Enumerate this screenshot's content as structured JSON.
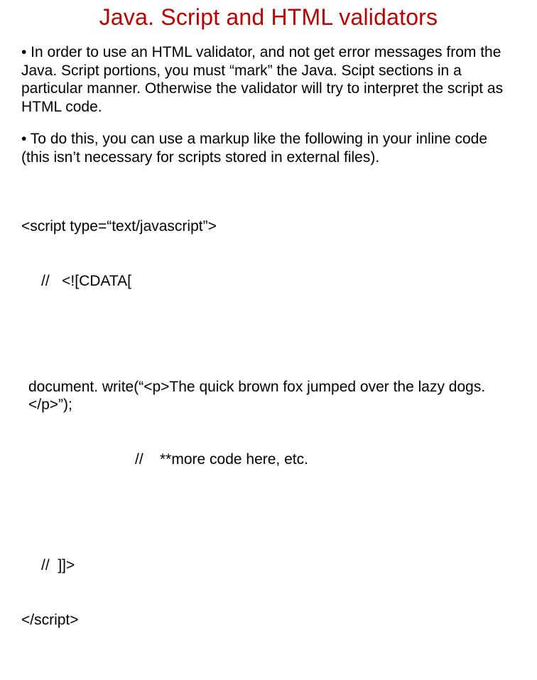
{
  "title": "Java. Script and HTML validators",
  "para1": "• In order to use an HTML validator, and not get error messages from the Java. Script portions, you must “mark” the Java. Scipt sections in a particular manner.  Otherwise the validator will try to interpret the script as HTML code.",
  "para2": "• To do this, you can use a markup like the following in your inline code (this isn’t necessary for scripts stored in external files).",
  "code": {
    "l1": "<script type=“text/javascript”>",
    "l2": "//   <![CDATA[",
    "l3": "document. write(“<p>The quick brown fox jumped over the lazy dogs. </p>”);",
    "l4": "//    **more code here, etc.",
    "l5": "//  ]]>",
    "l6": "</script>"
  }
}
